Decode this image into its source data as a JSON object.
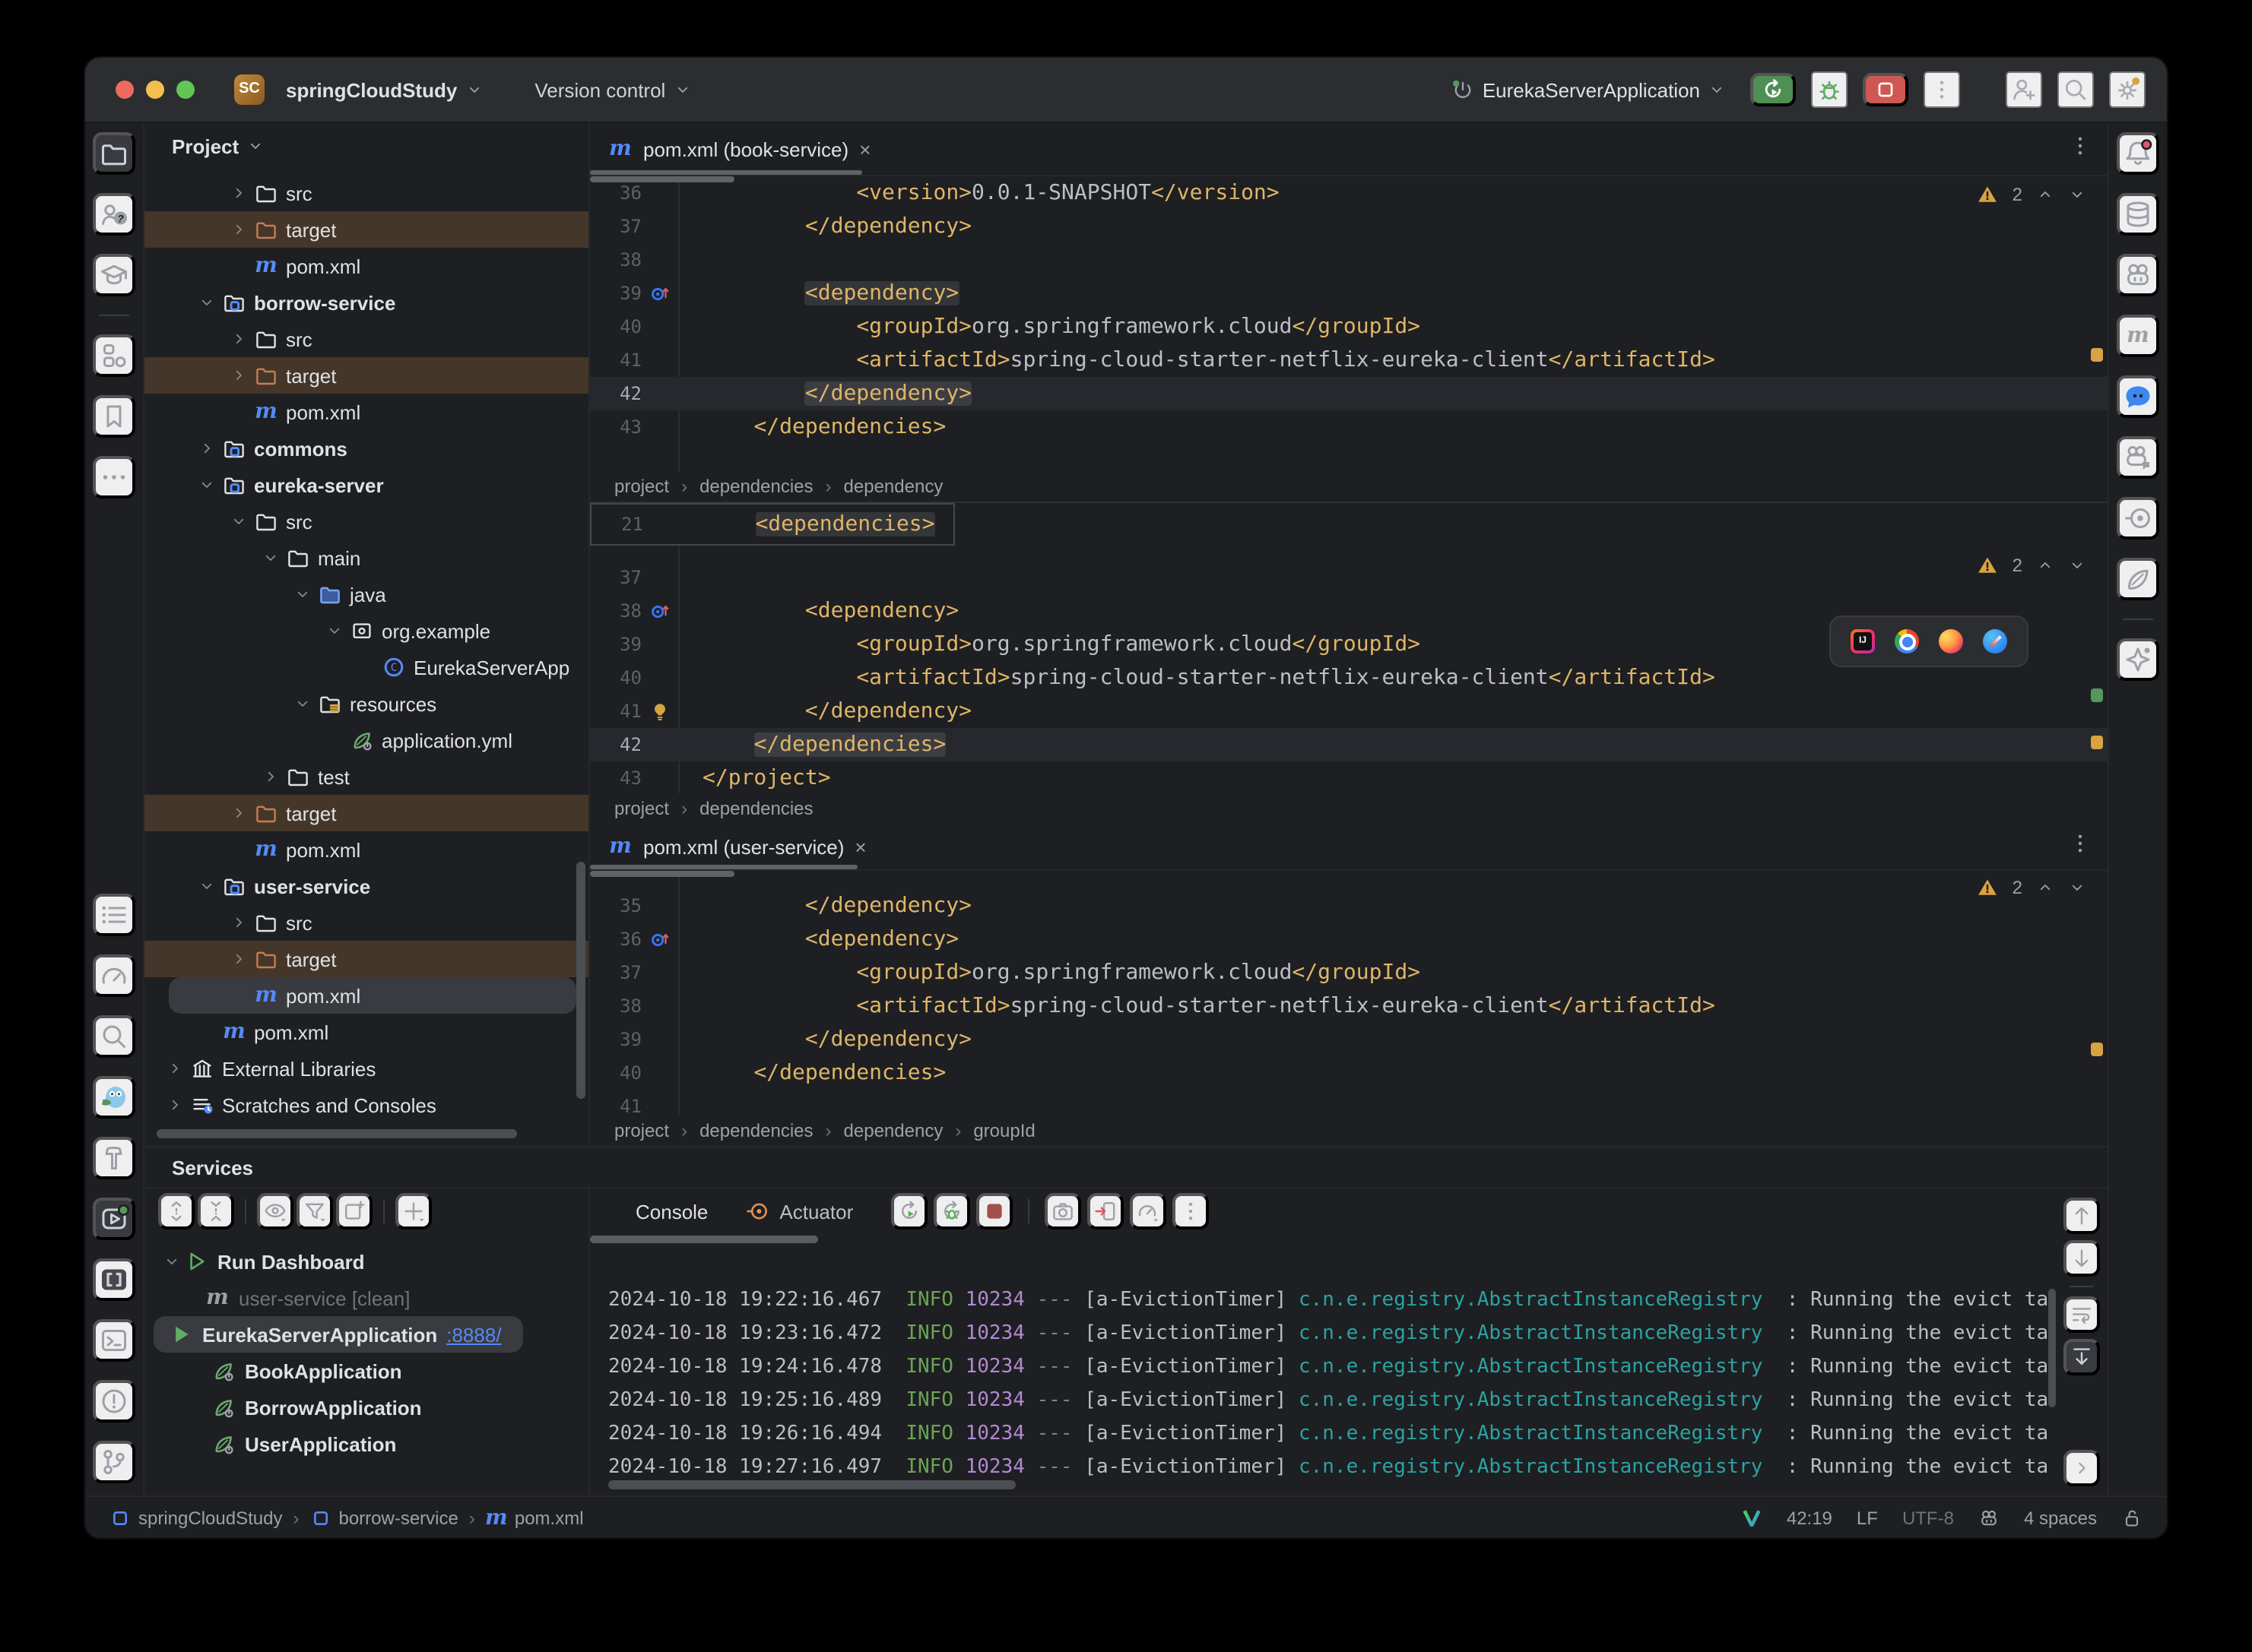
{
  "titlebar": {
    "badge": "SC",
    "project": "springCloudStudy",
    "vcs": "Version control",
    "run_config": "EurekaServerApplication"
  },
  "left_stripe": {
    "top": [
      {
        "icon": "folder",
        "name": "project-tool",
        "selected": true
      },
      {
        "icon": "users-help",
        "name": "learner-profiles"
      },
      {
        "icon": "grad-cap",
        "name": "learn"
      },
      {
        "divider": true
      },
      {
        "icon": "structure",
        "name": "structure-tool"
      },
      {
        "icon": "bookmark",
        "name": "bookmarks-tool"
      },
      {
        "icon": "dots-h",
        "name": "more-tools"
      }
    ],
    "bottom": [
      {
        "icon": "todo-list",
        "name": "todo-tool"
      },
      {
        "icon": "gauge",
        "name": "endpoints-tool"
      },
      {
        "icon": "search",
        "name": "find-tool"
      },
      {
        "icon": "mascot",
        "name": "plugin-mascot"
      },
      {
        "icon": "hammer",
        "name": "build-tool"
      },
      {
        "icon": "services-box",
        "name": "services-tool",
        "selected": true
      },
      {
        "icon": "brackets",
        "name": "snippets-tool"
      },
      {
        "icon": "terminal",
        "name": "terminal-tool"
      },
      {
        "icon": "problems",
        "name": "problems-tool"
      },
      {
        "icon": "git-branch",
        "name": "git-tool"
      }
    ]
  },
  "right_stripe": [
    {
      "icon": "bell",
      "name": "notifications"
    },
    {
      "icon": "database",
      "name": "database-tool"
    },
    {
      "icon": "robot",
      "name": "ai-plugin"
    },
    {
      "icon": "maven-gray",
      "name": "maven-tool"
    },
    {
      "icon": "chat-blue",
      "name": "chat-plugin"
    },
    {
      "icon": "robot-chat",
      "name": "assistant-plugin"
    },
    {
      "icon": "actuator-gray",
      "name": "actuator-tool"
    },
    {
      "icon": "leaf",
      "name": "spring-tool"
    },
    {
      "divider": true
    },
    {
      "icon": "sparkle",
      "name": "ai-assistant"
    }
  ],
  "project_panel": {
    "title": "Project",
    "items": [
      {
        "label": "src",
        "icon": "folder",
        "lvl": 2,
        "chev": "closed"
      },
      {
        "label": "target",
        "icon": "folder-ex",
        "lvl": 2,
        "chev": "closed",
        "hl": "brown"
      },
      {
        "label": "pom.xml",
        "icon": "maven",
        "lvl": 2
      },
      {
        "label": "borrow-service",
        "icon": "folder-module",
        "lvl": 1,
        "chev": "open",
        "bold": true
      },
      {
        "label": "src",
        "icon": "folder",
        "lvl": 2,
        "chev": "closed"
      },
      {
        "label": "target",
        "icon": "folder-ex",
        "lvl": 2,
        "chev": "closed",
        "hl": "brown"
      },
      {
        "label": "pom.xml",
        "icon": "maven",
        "lvl": 2
      },
      {
        "label": "commons",
        "icon": "folder-module",
        "lvl": 1,
        "chev": "closed",
        "bold": true
      },
      {
        "label": "eureka-server",
        "icon": "folder-module",
        "lvl": 1,
        "chev": "open",
        "bold": true
      },
      {
        "label": "src",
        "icon": "folder",
        "lvl": 2,
        "chev": "open"
      },
      {
        "label": "main",
        "icon": "folder",
        "lvl": 3,
        "chev": "open"
      },
      {
        "label": "java",
        "icon": "folder-src",
        "lvl": 4,
        "chev": "open"
      },
      {
        "label": "org.example",
        "icon": "package",
        "lvl": 5,
        "chev": "open"
      },
      {
        "label": "EurekaServerApp",
        "icon": "class-c",
        "lvl": 6
      },
      {
        "label": "resources",
        "icon": "folder-res",
        "lvl": 4,
        "chev": "open"
      },
      {
        "label": "application.yml",
        "icon": "spring",
        "lvl": 5
      },
      {
        "label": "test",
        "icon": "folder",
        "lvl": 3,
        "chev": "closed"
      },
      {
        "label": "target",
        "icon": "folder-ex",
        "lvl": 2,
        "chev": "closed",
        "hl": "brown"
      },
      {
        "label": "pom.xml",
        "icon": "maven",
        "lvl": 2
      },
      {
        "label": "user-service",
        "icon": "folder-module",
        "lvl": 1,
        "chev": "open",
        "bold": true
      },
      {
        "label": "src",
        "icon": "folder",
        "lvl": 2,
        "chev": "closed"
      },
      {
        "label": "target",
        "icon": "folder-ex",
        "lvl": 2,
        "chev": "closed",
        "hl": "brown"
      },
      {
        "label": "pom.xml",
        "icon": "maven",
        "lvl": 2,
        "hl": "sel"
      },
      {
        "label": "pom.xml",
        "icon": "maven",
        "lvl": 1
      },
      {
        "label": "External Libraries",
        "icon": "extlib",
        "lvl": 0,
        "chev": "closed"
      },
      {
        "label": "Scratches and Consoles",
        "icon": "scratches",
        "lvl": 0,
        "chev": "closed"
      }
    ]
  },
  "editor": {
    "panes": [
      {
        "tab": {
          "label": "pom.xml (book-service)"
        },
        "warning_count": "2",
        "lines": [
          {
            "n": "36",
            "code": "            <version>0.0.1-SNAPSHOT</version>"
          },
          {
            "n": "37",
            "code": "        </dependency>"
          },
          {
            "n": "38",
            "code": ""
          },
          {
            "n": "39",
            "code": "        <dependency>",
            "marker": "change",
            "hl": true
          },
          {
            "n": "40",
            "code": "            <groupId>org.springframework.cloud</groupId>"
          },
          {
            "n": "41",
            "code": "            <artifactId>spring-cloud-starter-netflix-eureka-client</artifactId>"
          },
          {
            "n": "42",
            "code": "        </dependency>",
            "current": true,
            "hl": true
          },
          {
            "n": "43",
            "code": "    </dependencies>"
          }
        ],
        "breadcrumb": [
          "project",
          "dependencies",
          "dependency"
        ],
        "marks": [
          {
            "color": "#d9a343",
            "top": "58%"
          }
        ]
      },
      {
        "sticky": {
          "n": "21",
          "code": "    <dependencies>",
          "hl": true
        },
        "warning_count": "2",
        "lines": [
          {
            "n": "37",
            "code": ""
          },
          {
            "n": "38",
            "code": "        <dependency>",
            "marker": "change"
          },
          {
            "n": "39",
            "code": "            <groupId>org.springframework.cloud</groupId>"
          },
          {
            "n": "40",
            "code": "            <artifactId>spring-cloud-starter-netflix-eureka-client</artifactId>"
          },
          {
            "n": "41",
            "code": "        </dependency>",
            "marker": "bulb"
          },
          {
            "n": "42",
            "code": "    </dependencies>",
            "current": true,
            "hl": true
          },
          {
            "n": "43",
            "code": "</project>"
          }
        ],
        "breadcrumb": [
          "project",
          "dependencies"
        ],
        "browser_bar": [
          "b-intellij",
          "b-chrome",
          "b-firefox",
          "b-safari"
        ],
        "marks": [
          {
            "color": "#57965c",
            "top": "64%"
          },
          {
            "color": "#d9a343",
            "top": "80%"
          }
        ]
      },
      {
        "tab": {
          "label": "pom.xml (user-service)"
        },
        "warning_count": "2",
        "lines": [
          {
            "n": "35",
            "code": "        </dependency>"
          },
          {
            "n": "36",
            "code": "        <dependency>",
            "marker": "change"
          },
          {
            "n": "37",
            "code": "            <groupId>org.springframework.cloud</groupId>"
          },
          {
            "n": "38",
            "code": "            <artifactId>spring-cloud-starter-netflix-eureka-client</artifactId>"
          },
          {
            "n": "39",
            "code": "        </dependency>"
          },
          {
            "n": "40",
            "code": "    </dependencies>"
          },
          {
            "n": "41",
            "code": ""
          }
        ],
        "breadcrumb": [
          "project",
          "dependencies",
          "dependency",
          "groupId"
        ],
        "marks": [
          {
            "color": "#d9a343",
            "top": "70%"
          }
        ]
      }
    ]
  },
  "services": {
    "title": "Services",
    "toolbar": [
      "expand-all",
      "collapse-all",
      "div",
      "eye",
      "filter",
      "tab-plus",
      "div",
      "plus"
    ],
    "tree": [
      {
        "label": "Run Dashboard",
        "icon": "run-outline",
        "chev": "open",
        "pad": 10
      },
      {
        "label": "user-service [clean]",
        "icon": "maven-gray",
        "pad": 40,
        "dim": true
      },
      {
        "label": "EurekaServerApplication",
        "link": ":8888/",
        "icon": "run-filled",
        "sel": true,
        "pad": 0
      },
      {
        "label": "BookApplication",
        "icon": "springboot",
        "pad": 44
      },
      {
        "label": "BorrowApplication",
        "icon": "springboot",
        "pad": 44
      },
      {
        "label": "UserApplication",
        "icon": "springboot",
        "pad": 44
      }
    ],
    "console": {
      "tabs": [
        {
          "label": "Console",
          "active": true
        },
        {
          "label": "Actuator",
          "icon": "actuator"
        }
      ],
      "toolbar": [
        "rerun-green",
        "rerun-debug",
        "stop-muted",
        "div",
        "camera",
        "exit-door",
        "gauge-caret",
        "more-v"
      ],
      "lines": [
        {
          "ts": "2024-10-18 19:22:16.467",
          "level": "INFO",
          "pid": "10234",
          "thread": "[a-EvictionTimer]",
          "logger": "c.n.e.registry.AbstractInstanceRegistry",
          "msg": ": Running the evict ta",
          "partial": true
        },
        {
          "ts": "2024-10-18 19:23:16.472",
          "level": "INFO",
          "pid": "10234",
          "thread": "[a-EvictionTimer]",
          "logger": "c.n.e.registry.AbstractInstanceRegistry",
          "msg": ": Running the evict ta"
        },
        {
          "ts": "2024-10-18 19:24:16.478",
          "level": "INFO",
          "pid": "10234",
          "thread": "[a-EvictionTimer]",
          "logger": "c.n.e.registry.AbstractInstanceRegistry",
          "msg": ": Running the evict ta"
        },
        {
          "ts": "2024-10-18 19:25:16.489",
          "level": "INFO",
          "pid": "10234",
          "thread": "[a-EvictionTimer]",
          "logger": "c.n.e.registry.AbstractInstanceRegistry",
          "msg": ": Running the evict ta"
        },
        {
          "ts": "2024-10-18 19:26:16.494",
          "level": "INFO",
          "pid": "10234",
          "thread": "[a-EvictionTimer]",
          "logger": "c.n.e.registry.AbstractInstanceRegistry",
          "msg": ": Running the evict ta"
        },
        {
          "ts": "2024-10-18 19:27:16.497",
          "level": "INFO",
          "pid": "10234",
          "thread": "[a-EvictionTimer]",
          "logger": "c.n.e.registry.AbstractInstanceRegistry",
          "msg": ": Running the evict ta"
        }
      ]
    }
  },
  "status_bar": {
    "left": [
      {
        "icon": "module-sq",
        "label": "springCloudStudy"
      },
      {
        "icon": "module-sq",
        "label": "borrow-service"
      },
      {
        "icon": "maven",
        "label": "pom.xml"
      }
    ],
    "right": [
      {
        "icon": "vim-v"
      },
      {
        "label": "42:19"
      },
      {
        "label": "LF"
      },
      {
        "label": "UTF-8",
        "dim": true
      },
      {
        "icon": "robot-status"
      },
      {
        "label": "4 spaces"
      },
      {
        "icon": "lock-open"
      }
    ]
  }
}
